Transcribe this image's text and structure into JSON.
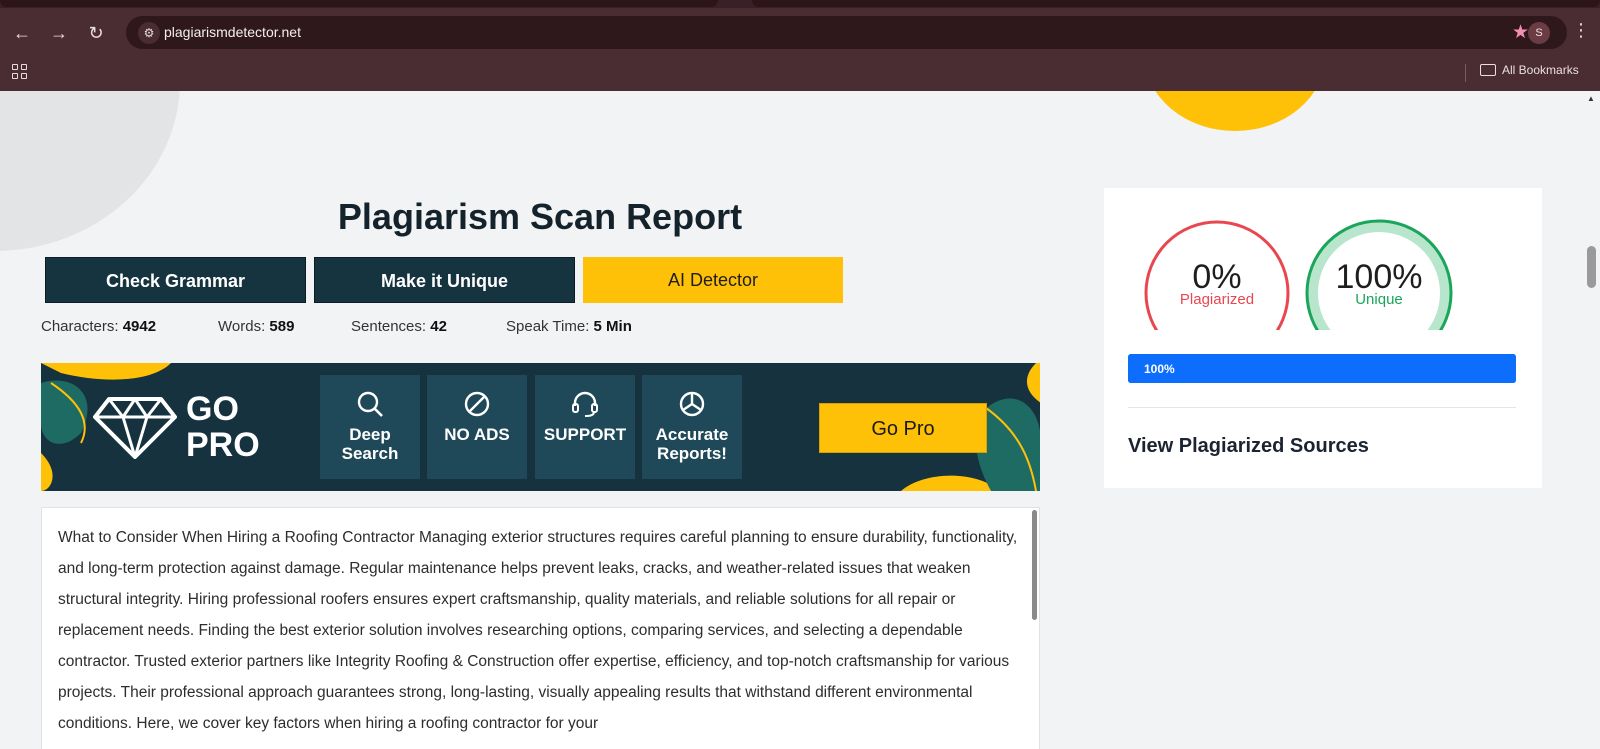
{
  "browser": {
    "url": "plagiarismdetector.net",
    "profile_initial": "S",
    "bookmarks_label": "All Bookmarks"
  },
  "page": {
    "title": "Plagiarism Scan Report",
    "buttons": {
      "check_grammar": "Check Grammar",
      "make_unique": "Make it Unique",
      "ai_detector": "AI Detector"
    },
    "stats": {
      "characters_label": "Characters:",
      "characters_value": "4942",
      "words_label": "Words:",
      "words_value": "589",
      "sentences_label": "Sentences:",
      "sentences_value": "42",
      "speak_label": "Speak Time:",
      "speak_value": "5 Min"
    },
    "banner": {
      "go": "GO",
      "pro": "PRO",
      "features": [
        {
          "line1": "Deep",
          "line2": "Search"
        },
        {
          "line1": "NO ADS",
          "line2": ""
        },
        {
          "line1": "SUPPORT",
          "line2": ""
        },
        {
          "line1": "Accurate",
          "line2": "Reports!"
        }
      ],
      "cta": "Go Pro"
    },
    "content_text": "What to Consider When Hiring a Roofing Contractor Managing exterior structures requires careful planning to ensure durability, functionality, and long-term protection against damage. Regular maintenance helps prevent leaks, cracks, and weather-related issues that weaken structural integrity. Hiring professional roofers ensures expert craftsmanship, quality materials, and reliable solutions for all repair or replacement needs. Finding the best exterior solution involves researching options, comparing services, and selecting a dependable contractor. Trusted exterior partners like Integrity Roofing & Construction offer expertise, efficiency, and top-notch craftsmanship for various projects. Their professional approach guarantees strong, long-lasting, visually appealing results that withstand different environmental conditions. Here, we cover key factors when hiring a roofing contractor for your"
  },
  "report": {
    "plagiarized_pct": "0%",
    "plagiarized_label": "Plagiarized",
    "unique_pct": "100%",
    "unique_label": "Unique",
    "progress_text": "100%",
    "progress_value": 100,
    "sources_heading": "View Plagiarized Sources",
    "colors": {
      "plagiarized": "#e8474f",
      "unique": "#1aa55a",
      "unique_track": "#b7e6cd",
      "progress": "#0d6efd",
      "accent_yellow": "#ffc107",
      "dark_teal": "#163440"
    }
  }
}
